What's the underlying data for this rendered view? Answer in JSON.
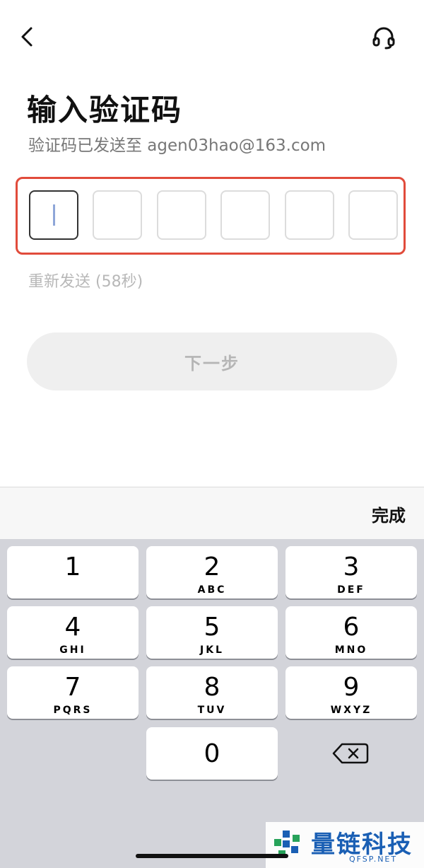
{
  "header": {
    "title": "输入验证码",
    "subtitle": "验证码已发送至 agen03hao@163.com"
  },
  "otp": {
    "length": 6,
    "active_index": 0,
    "highlight_color": "#e14b3b"
  },
  "resend_label": "重新发送 (58秒)",
  "next_button_label": "下一步",
  "keyboard": {
    "done_label": "完成",
    "keys": [
      {
        "num": "1",
        "letters": ""
      },
      {
        "num": "2",
        "letters": "ABC"
      },
      {
        "num": "3",
        "letters": "DEF"
      },
      {
        "num": "4",
        "letters": "GHI"
      },
      {
        "num": "5",
        "letters": "JKL"
      },
      {
        "num": "6",
        "letters": "MNO"
      },
      {
        "num": "7",
        "letters": "PQRS"
      },
      {
        "num": "8",
        "letters": "TUV"
      },
      {
        "num": "9",
        "letters": "WXYZ"
      },
      {
        "num": "0",
        "letters": ""
      }
    ]
  },
  "watermark": {
    "text": "量链科技",
    "sub": "QFSP.NET"
  },
  "icons": {
    "back": "chevron-left-icon",
    "support": "headset-icon",
    "delete": "backspace-icon"
  }
}
